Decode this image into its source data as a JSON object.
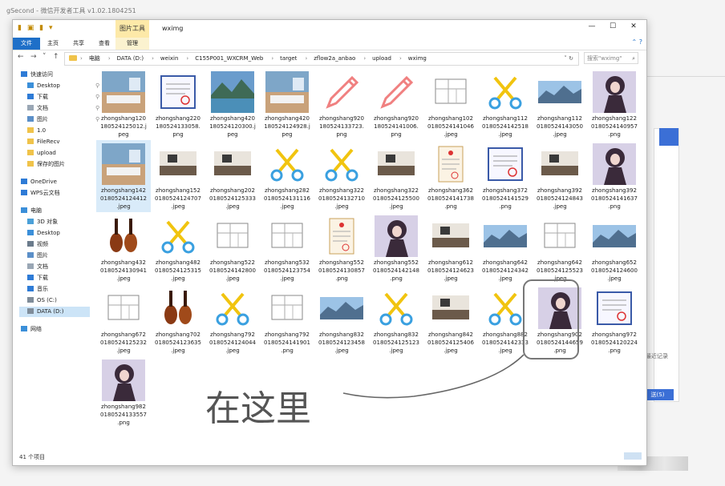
{
  "background": {
    "title": "gSecond - 微信开发者工具 v1.02.1804251",
    "link": "最近记录",
    "button": "送(S)"
  },
  "window": {
    "quick_access": "▮ ▣ ▮ ▾",
    "context_tab": "图片工具",
    "title": "wximg",
    "controls": [
      "—",
      "☐",
      "✕"
    ],
    "tabs": [
      "文件",
      "主页",
      "共享",
      "查看",
      "管理"
    ],
    "help": "⌃ ?",
    "nav_buttons": [
      "←",
      "→",
      "˅",
      "↑"
    ],
    "breadcrumb": [
      "电脑",
      "DATA (D:)",
      "weixin",
      "C155P001_WXCRM_Web",
      "target",
      "zflow2a_anbao",
      "upload",
      "wximg"
    ],
    "addr_controls": "˅ ↻",
    "search_placeholder": "搜索\"wximg\"",
    "status": "41 个项目"
  },
  "sidebar": [
    {
      "label": "快速访问",
      "icon": "star-icon",
      "pin": false
    },
    {
      "label": "Desktop",
      "icon": "desktop-icon",
      "pin": true
    },
    {
      "label": "下载",
      "icon": "download-icon",
      "pin": true
    },
    {
      "label": "文档",
      "icon": "document-icon",
      "pin": true
    },
    {
      "label": "图片",
      "icon": "picture-icon",
      "pin": true
    },
    {
      "label": "1.0",
      "icon": "folder-icon",
      "pin": false
    },
    {
      "label": "FileRecv",
      "icon": "folder-icon",
      "pin": false
    },
    {
      "label": "upload",
      "icon": "folder-icon",
      "pin": false
    },
    {
      "label": "保存的图片",
      "icon": "folder-icon",
      "pin": false
    },
    {
      "label": "OneDrive",
      "icon": "cloud-icon",
      "pin": false
    },
    {
      "label": "WPS云文档",
      "icon": "cloud-icon",
      "pin": false
    },
    {
      "label": "电脑",
      "icon": "computer-icon",
      "pin": false
    },
    {
      "label": "3D 对象",
      "icon": "3d-objects-icon",
      "pin": false
    },
    {
      "label": "Desktop",
      "icon": "desktop-icon",
      "pin": false
    },
    {
      "label": "视频",
      "icon": "video-icon",
      "pin": false
    },
    {
      "label": "图片",
      "icon": "picture-icon",
      "pin": false
    },
    {
      "label": "文档",
      "icon": "document-icon",
      "pin": false
    },
    {
      "label": "下载",
      "icon": "download-icon",
      "pin": false
    },
    {
      "label": "音乐",
      "icon": "music-icon",
      "pin": false
    },
    {
      "label": "OS (C:)",
      "icon": "drive-icon",
      "pin": false
    },
    {
      "label": "DATA (D:)",
      "icon": "drive-icon",
      "pin": false,
      "selected": true
    },
    {
      "label": "网络",
      "icon": "network-icon",
      "pin": false
    }
  ],
  "files": [
    {
      "name": "zhongshang120180524125012.jpeg",
      "lines": [
        "zhongshang120",
        "180524125012.j",
        "peg"
      ],
      "thumb": "room"
    },
    {
      "name": "zhongshang220180524133058.png",
      "lines": [
        "zhongshang220",
        "180524133058.",
        "png"
      ],
      "thumb": "certificate"
    },
    {
      "name": "zhongshang420180524120300.jpeg",
      "lines": [
        "zhongshang420",
        "180524120300.j",
        "peg"
      ],
      "thumb": "lake"
    },
    {
      "name": "zhongshang420180524124928.jpeg",
      "lines": [
        "zhongshang420",
        "180524124928.j",
        "peg"
      ],
      "thumb": "room"
    },
    {
      "name": "zhongshang920180524133723.png",
      "lines": [
        "zhongshang920",
        "180524133723.",
        "png"
      ],
      "thumb": "pencil"
    },
    {
      "name": "zhongshang920180524141006.png",
      "lines": [
        "zhongshang920",
        "180524141006.",
        "png"
      ],
      "thumb": "pencil"
    },
    {
      "name": "zhongshang1020180524141046.jpeg",
      "lines": [
        "zhongshang102",
        "0180524141046",
        ".jpeg"
      ],
      "thumb": "sketch"
    },
    {
      "name": "zhongshang1120180524142518.jpeg",
      "lines": [
        "zhongshang112",
        "0180524142518",
        ".jpeg"
      ],
      "thumb": "scissors"
    },
    {
      "name": "zhongshang1120180524143050.jpeg",
      "lines": [
        "zhongshang112",
        "0180524143050",
        ".jpeg"
      ],
      "thumb": "mountain"
    },
    {
      "name": "zhongshang1220180524140957.png",
      "lines": [
        "zhongshang122",
        "0180524140957",
        ".png"
      ],
      "thumb": "girl"
    },
    {
      "name": "zhongshang1420180524124412.jpeg",
      "lines": [
        "zhongshang142",
        "0180524124412",
        ".jpeg"
      ],
      "thumb": "room",
      "selected": true
    },
    {
      "name": "zhongshang1520180524124707.jpeg",
      "lines": [
        "zhongshang152",
        "0180524124707",
        ".jpeg"
      ],
      "thumb": "interior"
    },
    {
      "name": "zhongshang2020180524125333.jpeg",
      "lines": [
        "zhongshang202",
        "0180524125333",
        ".jpeg"
      ],
      "thumb": "interior"
    },
    {
      "name": "zhongshang2820180524131116.jpeg",
      "lines": [
        "zhongshang282",
        "0180524131116",
        ".jpeg"
      ],
      "thumb": "scissors"
    },
    {
      "name": "zhongshang3220180524132710.jpeg",
      "lines": [
        "zhongshang322",
        "0180524132710",
        ".jpeg"
      ],
      "thumb": "scissors"
    },
    {
      "name": "zhongshang3220180524125500.jpeg",
      "lines": [
        "zhongshang322",
        "0180524125500",
        ".jpeg"
      ],
      "thumb": "interior"
    },
    {
      "name": "zhongshang3620180524141738.png",
      "lines": [
        "zhongshang362",
        "0180524141738",
        ".png"
      ],
      "thumb": "license"
    },
    {
      "name": "zhongshang3720180524141529.png",
      "lines": [
        "zhongshang372",
        "0180524141529",
        ".png"
      ],
      "thumb": "certificate"
    },
    {
      "name": "zhongshang3920180524124843.jpeg",
      "lines": [
        "zhongshang392",
        "0180524124843",
        ".jpeg"
      ],
      "thumb": "interior"
    },
    {
      "name": "zhongshang3920180524141637.png",
      "lines": [
        "zhongshang392",
        "0180524141637",
        ".png"
      ],
      "thumb": "girl"
    },
    {
      "name": "zhongshang4320180524130941.jpeg",
      "lines": [
        "zhongshang432",
        "0180524130941",
        ".jpeg"
      ],
      "thumb": "violin"
    },
    {
      "name": "zhongshang4820180524125315.jpeg",
      "lines": [
        "zhongshang482",
        "0180524125315",
        ".jpeg"
      ],
      "thumb": "scissors"
    },
    {
      "name": "zhongshang5220180524142800.jpeg",
      "lines": [
        "zhongshang522",
        "0180524142800",
        ".jpeg"
      ],
      "thumb": "sketch"
    },
    {
      "name": "zhongshang5320180524123754.jpeg",
      "lines": [
        "zhongshang532",
        "0180524123754",
        ".jpeg"
      ],
      "thumb": "sketch"
    },
    {
      "name": "zhongshang5520180524130857.png",
      "lines": [
        "zhongshang552",
        "0180524130857",
        ".png"
      ],
      "thumb": "license"
    },
    {
      "name": "zhongshang5520180524142148.png",
      "lines": [
        "zhongshang552",
        "0180524142148",
        ".png"
      ],
      "thumb": "girl"
    },
    {
      "name": "zhongshang6120180524124623.jpeg",
      "lines": [
        "zhongshang612",
        "0180524124623",
        ".jpeg"
      ],
      "thumb": "interior"
    },
    {
      "name": "zhongshang6420180524124342.jpeg",
      "lines": [
        "zhongshang642",
        "0180524124342",
        ".jpeg"
      ],
      "thumb": "mountain"
    },
    {
      "name": "zhongshang6420180524125523.jpeg",
      "lines": [
        "zhongshang642",
        "0180524125523",
        ".jpeg"
      ],
      "thumb": "sketch"
    },
    {
      "name": "zhongshang6520180524124600.jpeg",
      "lines": [
        "zhongshang652",
        "0180524124600",
        ".jpeg"
      ],
      "thumb": "mountain"
    },
    {
      "name": "zhongshang6720180524125232.jpeg",
      "lines": [
        "zhongshang672",
        "0180524125232",
        ".jpeg"
      ],
      "thumb": "sketch"
    },
    {
      "name": "zhongshang7020180524123635.jpeg",
      "lines": [
        "zhongshang702",
        "0180524123635",
        ".jpeg"
      ],
      "thumb": "violin"
    },
    {
      "name": "zhongshang7920180524124044.jpeg",
      "lines": [
        "zhongshang792",
        "0180524124044",
        ".jpeg"
      ],
      "thumb": "scissors"
    },
    {
      "name": "zhongshang7920180524141901.png",
      "lines": [
        "zhongshang792",
        "0180524141901",
        ".png"
      ],
      "thumb": "sketch"
    },
    {
      "name": "zhongshang8320180524123458.jpeg",
      "lines": [
        "zhongshang832",
        "0180524123458",
        ".jpeg"
      ],
      "thumb": "mountain"
    },
    {
      "name": "zhongshang8320180524125123.jpeg",
      "lines": [
        "zhongshang832",
        "0180524125123",
        ".jpeg"
      ],
      "thumb": "scissors"
    },
    {
      "name": "zhongshang8420180524125406.jpeg",
      "lines": [
        "zhongshang842",
        "0180524125406",
        ".jpeg"
      ],
      "thumb": "interior"
    },
    {
      "name": "zhongshang8820180524142333.jpeg",
      "lines": [
        "zhongshang882",
        "0180524142333",
        ".jpeg"
      ],
      "thumb": "scissors"
    },
    {
      "name": "zhongshang9020180524144659.png",
      "lines": [
        "zhongshang902",
        "0180524144659",
        ".png"
      ],
      "thumb": "girl",
      "circled": true
    },
    {
      "name": "zhongshang9720180524120224.png",
      "lines": [
        "zhongshang972",
        "0180524120224",
        ".png"
      ],
      "thumb": "certificate"
    },
    {
      "name": "zhongshang9820180524133557.png",
      "lines": [
        "zhongshang982",
        "0180524133557",
        ".png"
      ],
      "thumb": "girl"
    }
  ],
  "annotation": {
    "handwriting": "在这里"
  },
  "colors": {
    "accent": "#1e6fc8",
    "context_tab": "#fde9a8",
    "selection": "#cce4f7",
    "annotation": "#666666"
  }
}
